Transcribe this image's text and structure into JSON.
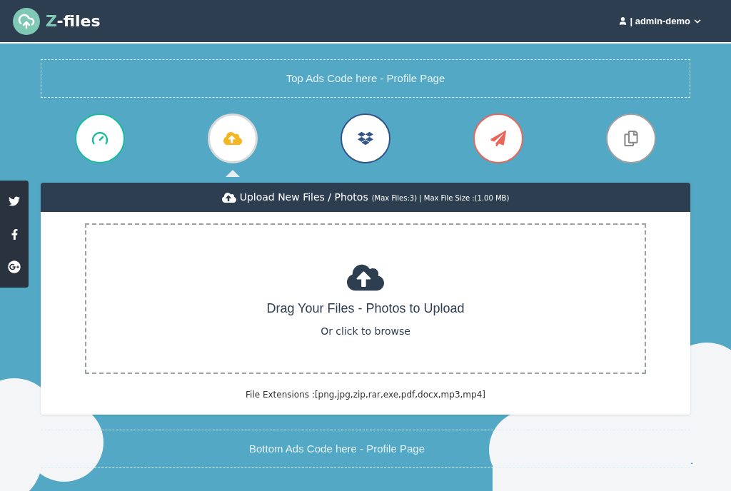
{
  "header": {
    "logo": {
      "accent": "Z",
      "rest": "-files"
    },
    "user_menu": "| admin-demo"
  },
  "top_ad": "Top Ads Code here - Profile Page",
  "nav": [
    {
      "kind": "dashboard",
      "color": "#1abc9c",
      "selected": false
    },
    {
      "kind": "upload",
      "color": "#d9d9d9",
      "selected": true
    },
    {
      "kind": "dropbox",
      "color": "#34558b",
      "selected": false
    },
    {
      "kind": "send",
      "color": "#e8675a",
      "selected": false
    },
    {
      "kind": "files",
      "color": "#a0a0a0",
      "selected": false
    }
  ],
  "social": [
    {
      "kind": "twitter"
    },
    {
      "kind": "facebook"
    },
    {
      "kind": "googleplus"
    }
  ],
  "upload_panel": {
    "title": "Upload New Files / Photos",
    "limits": "(Max Files:3) | Max File Size :(1.00 MB)",
    "dropzone": {
      "heading": "Drag Your Files - Photos to Upload",
      "hint": "Or click to browse"
    },
    "extensions": "File Extensions :[png,jpg,zip,rar,exe,pdf,docx,mp3,mp4]"
  },
  "bottom_ad": "Bottom Ads Code here - Profile Page"
}
